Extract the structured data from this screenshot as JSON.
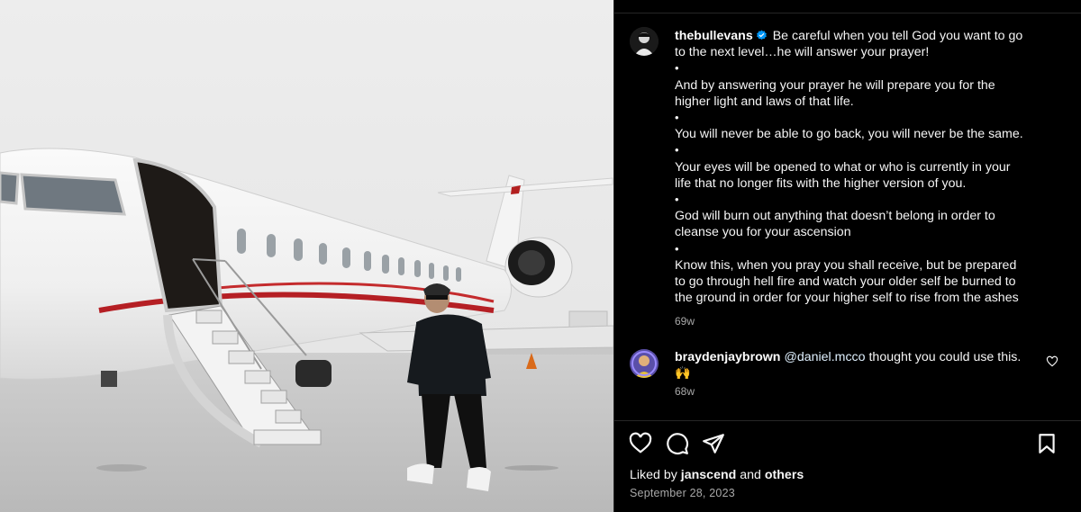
{
  "post": {
    "author": "thebullevans",
    "caption": {
      "line1_rest": "Be careful when you tell God you want to go",
      "lines": [
        "to the next level…he will answer your prayer!",
        "•",
        "And by answering your prayer he will prepare you for the",
        "higher light and laws of that life.",
        "•",
        "You will never be able to go back, you will never be the same.",
        "•",
        "Your eyes will be opened to what or who is currently in your",
        "life that no longer fits with the higher version of you.",
        "•",
        "God will burn out anything that doesn’t belong in order to",
        "cleanse you for your ascension",
        "•",
        "Know this, when you pray you shall receive, but be prepared",
        "to go through hell fire and watch your older self be burned to",
        "the ground in order for your higher self to rise from the ashes"
      ],
      "time": "69w"
    },
    "comment": {
      "author": "braydenjaybrown",
      "mention": "@daniel.mcco",
      "text": " thought you could use this.",
      "emoji": "🙌",
      "time": "68w"
    },
    "likes": {
      "prefix": "Liked by ",
      "user": "janscend",
      "middle": " and ",
      "others": "others"
    },
    "date": "September 28, 2023"
  },
  "icons": {
    "like": "heart-icon",
    "comment": "comment-icon",
    "share": "paper-plane-icon",
    "save": "bookmark-icon",
    "verified": "verified-badge-icon",
    "comment_like": "heart-outline-icon"
  },
  "colors": {
    "background": "#000000",
    "text": "#f5f5f5",
    "muted": "#a8a8a8",
    "verified": "#0095f6",
    "divider": "#262626"
  }
}
